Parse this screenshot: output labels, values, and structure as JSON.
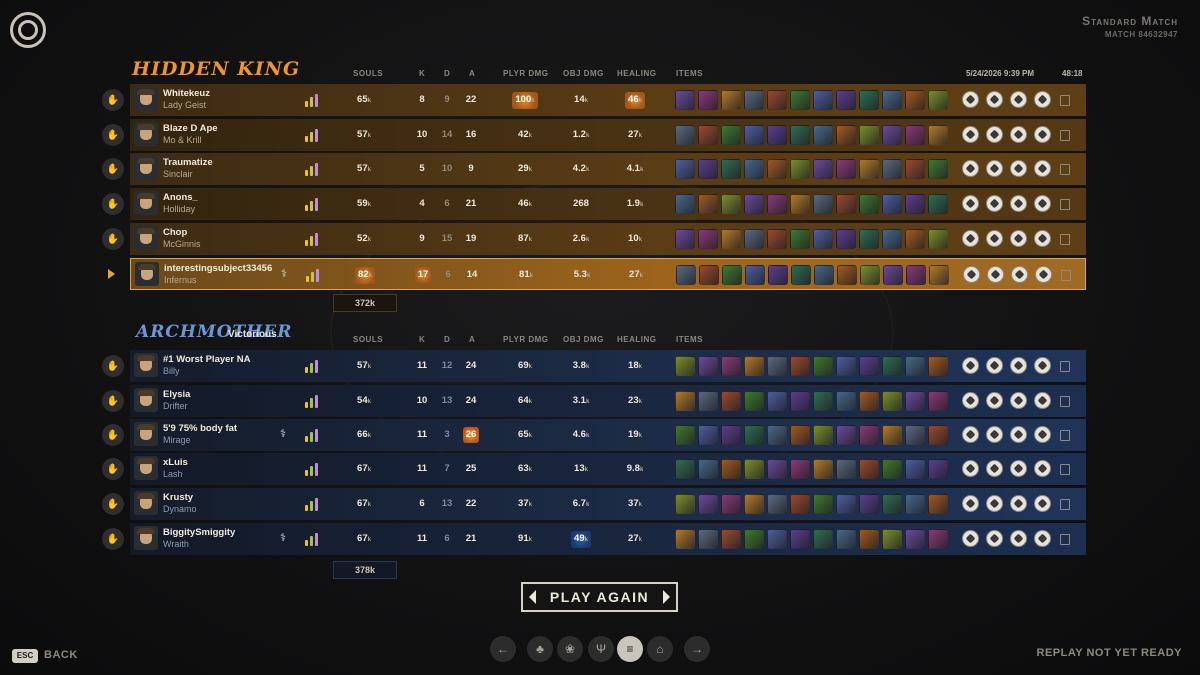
{
  "match": {
    "title": "Standard Match",
    "id": "MATCH 84632947",
    "date": "5/24/2026 9:39 PM",
    "duration": "48:18"
  },
  "columns": {
    "souls": "SOULS",
    "k": "K",
    "d": "D",
    "a": "A",
    "plyr_dmg": "PLYR DMG",
    "obj_dmg": "OBJ DMG",
    "healing": "HEALING",
    "items": "ITEMS"
  },
  "teams": [
    {
      "name": "HIDDEN KING",
      "status": "",
      "accent": "#f0952c",
      "souls_total": "372k",
      "players": [
        {
          "name": "Whitekeuz",
          "hero": "Lady Geist",
          "souls": "65",
          "k": "8",
          "d": "9",
          "a": "22",
          "plyr_dmg": "100",
          "obj_dmg": "14",
          "healing": "46",
          "badges": [
            "plyr_dmg",
            "healing"
          ]
        },
        {
          "name": "Blaze D Ape",
          "hero": "Mo & Krill",
          "souls": "57",
          "k": "10",
          "d": "14",
          "a": "16",
          "plyr_dmg": "42",
          "obj_dmg": "1.2",
          "healing": "27"
        },
        {
          "name": "Traumatize",
          "hero": "Sinclair",
          "souls": "57",
          "k": "5",
          "d": "10",
          "a": "9",
          "plyr_dmg": "29",
          "obj_dmg": "4.2",
          "healing": "4.1"
        },
        {
          "name": "Anons_",
          "hero": "Holliday",
          "souls": "59",
          "k": "4",
          "d": "6",
          "a": "21",
          "plyr_dmg": "46",
          "obj_dmg": "268",
          "healing": "1.9"
        },
        {
          "name": "Chop",
          "hero": "McGinnis",
          "souls": "52",
          "k": "9",
          "d": "15",
          "a": "19",
          "plyr_dmg": "87",
          "obj_dmg": "2.6",
          "healing": "10"
        },
        {
          "name": "interestingsubject33456",
          "hero": "Infernus",
          "souls": "82",
          "k": "17",
          "d": "6",
          "a": "14",
          "plyr_dmg": "81",
          "obj_dmg": "5.3",
          "healing": "27",
          "is_me": true,
          "badges": [
            "souls",
            "k"
          ]
        }
      ]
    },
    {
      "name": "ARCHMOTHER",
      "status": "Victorious",
      "accent": "#6b97d8",
      "souls_total": "378k",
      "players": [
        {
          "name": "#1 Worst Player NA",
          "hero": "Billy",
          "souls": "57",
          "k": "11",
          "d": "12",
          "a": "24",
          "plyr_dmg": "69",
          "obj_dmg": "3.8",
          "healing": "18"
        },
        {
          "name": "Elysia",
          "hero": "Drifter",
          "souls": "54",
          "k": "10",
          "d": "13",
          "a": "24",
          "plyr_dmg": "64",
          "obj_dmg": "3.1",
          "healing": "23"
        },
        {
          "name": "5'9 75% body fat",
          "hero": "Mirage",
          "souls": "66",
          "k": "11",
          "d": "3",
          "a": "26",
          "plyr_dmg": "65",
          "obj_dmg": "4.6",
          "healing": "19",
          "badges": [
            "a"
          ]
        },
        {
          "name": "xLuis",
          "hero": "Lash",
          "souls": "67",
          "k": "11",
          "d": "7",
          "a": "25",
          "plyr_dmg": "63",
          "obj_dmg": "13",
          "healing": "9.8"
        },
        {
          "name": "Krusty",
          "hero": "Dynamo",
          "souls": "67",
          "k": "6",
          "d": "13",
          "a": "22",
          "plyr_dmg": "37",
          "obj_dmg": "6.7",
          "healing": "37"
        },
        {
          "name": "BiggitySmiggity",
          "hero": "Wraith",
          "souls": "67",
          "k": "11",
          "d": "6",
          "a": "21",
          "plyr_dmg": "91",
          "obj_dmg": "49",
          "healing": "27",
          "badges": [
            "obj_dmg"
          ]
        }
      ]
    }
  ],
  "k_suffix": "k",
  "buttons": {
    "play_again": "PLAY AGAIN",
    "esc": "ESC",
    "back": "BACK"
  },
  "replay_status": "REPLAY NOT YET READY",
  "nav_icons": [
    "arrow-left-icon",
    "trophy-icon",
    "timeline-icon",
    "trident-icon",
    "scoreboard-icon",
    "chart-icon",
    "arrow-right-icon"
  ],
  "colors": {
    "item_orange": "#b5651d",
    "item_green": "#4d8a2f",
    "item_purple": "#7b4fb0"
  }
}
